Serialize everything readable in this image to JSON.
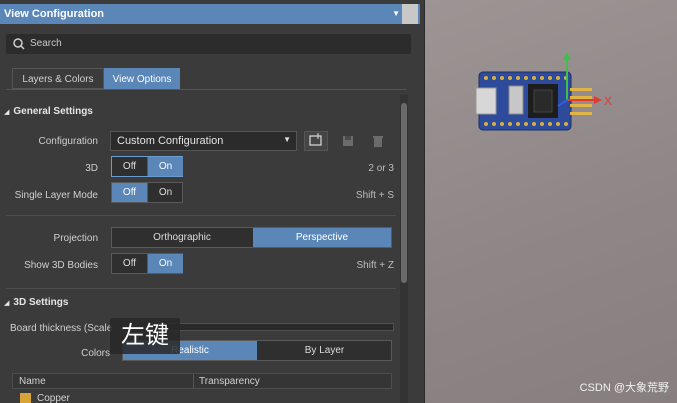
{
  "panel": {
    "title": "View Configuration",
    "search_placeholder": "Search",
    "tabs": [
      {
        "label": "Layers & Colors",
        "active": false
      },
      {
        "label": "View Options",
        "active": true
      }
    ]
  },
  "general": {
    "heading": "General Settings",
    "configuration_label": "Configuration",
    "configuration_value": "Custom Configuration",
    "threeD_label": "3D",
    "threeD_state": "On",
    "threeD_hint": "2 or 3",
    "single_layer_label": "Single Layer Mode",
    "single_layer_state": "Off",
    "single_layer_hint": "Shift + S",
    "projection_label": "Projection",
    "projection_options": [
      "Orthographic",
      "Perspective"
    ],
    "projection_selected": "Perspective",
    "show_bodies_label": "Show 3D Bodies",
    "show_bodies_state": "On",
    "show_bodies_hint": "Shift + Z",
    "off_label": "Off",
    "on_label": "On"
  },
  "settings3d": {
    "heading": "3D Settings",
    "board_thickness_label": "Board thickness (Scale",
    "colors_label": "Colors",
    "colors_options": [
      "Realistic",
      "By Layer"
    ],
    "colors_selected": "Realistic",
    "table_headers": [
      "Name",
      "Transparency"
    ],
    "rows": [
      {
        "name": "Copper",
        "color": "#d9a437"
      }
    ]
  },
  "overlay_text": "左键",
  "watermark": "CSDN @大象荒野",
  "viewport": {
    "axis_label_x": "X"
  },
  "colors": {
    "accent": "#5a86b8",
    "panel": "#3b3b3b",
    "viewport": "#938b8b"
  }
}
